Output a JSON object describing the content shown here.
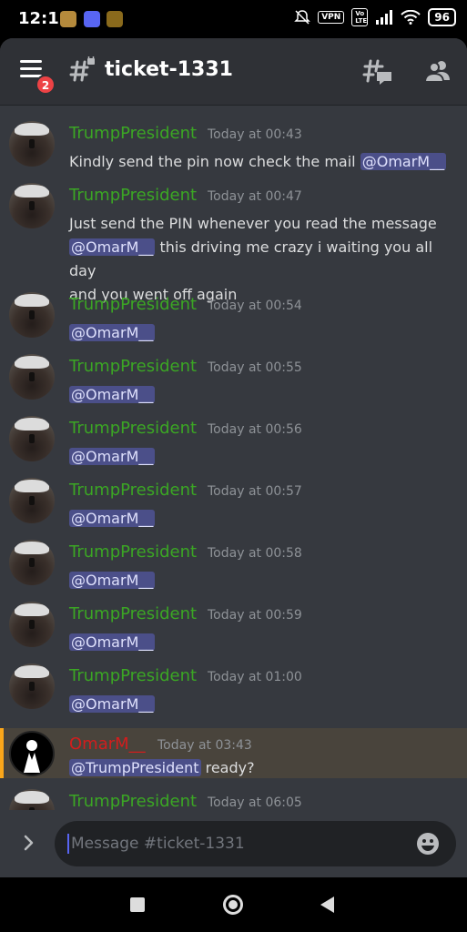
{
  "status_bar": {
    "time": "12:11",
    "vpn": "VPN",
    "volte": "Vo LTE",
    "battery": "96"
  },
  "header": {
    "badge_count": "2",
    "channel_name": "ticket-1331"
  },
  "messages": [
    {
      "author": "TrumpPresident",
      "time": "Today at 00:43",
      "pre": "Kindly send the pin now check the mail ",
      "mention": "@OmarM__",
      "post": ""
    },
    {
      "author": "TrumpPresident",
      "time": "Today at 00:47",
      "line1": "Just send the PIN whenever you read the message",
      "mention": "@OmarM__",
      "line2_post": "  this driving me crazy i waiting you all day",
      "line3": "and you went off again"
    },
    {
      "author": "TrumpPresident",
      "time": "Today at 00:54",
      "mention": "@OmarM__"
    },
    {
      "author": "TrumpPresident",
      "time": "Today at 00:55",
      "mention": "@OmarM__"
    },
    {
      "author": "TrumpPresident",
      "time": "Today at 00:56",
      "mention": "@OmarM__"
    },
    {
      "author": "TrumpPresident",
      "time": "Today at 00:57",
      "mention": "@OmarM__"
    },
    {
      "author": "TrumpPresident",
      "time": "Today at 00:58",
      "mention": "@OmarM__"
    },
    {
      "author": "TrumpPresident",
      "time": "Today at 00:59",
      "mention": "@OmarM__"
    },
    {
      "author": "TrumpPresident",
      "time": "Today at 01:00",
      "mention": "@OmarM__"
    },
    {
      "author": "OmarM__",
      "time": "Today at 03:43",
      "mention": "@TrumpPresident",
      "post": " ready?"
    },
    {
      "author": "TrumpPresident",
      "time": "Today at 06:05"
    }
  ],
  "composer": {
    "placeholder": "Message #ticket-1331"
  },
  "colors": {
    "background": "#36393f",
    "header": "#2f3136",
    "trump_name": "#3ba624",
    "omar_name": "#d21d1d",
    "mention_bg": "#4b4f89",
    "highlight_bg": "#49443c",
    "highlight_bar": "#faa61a"
  },
  "icons": [
    "menu-icon",
    "text-channel-icon",
    "threads-icon",
    "members-icon",
    "expand-icon",
    "emoji-icon"
  ]
}
